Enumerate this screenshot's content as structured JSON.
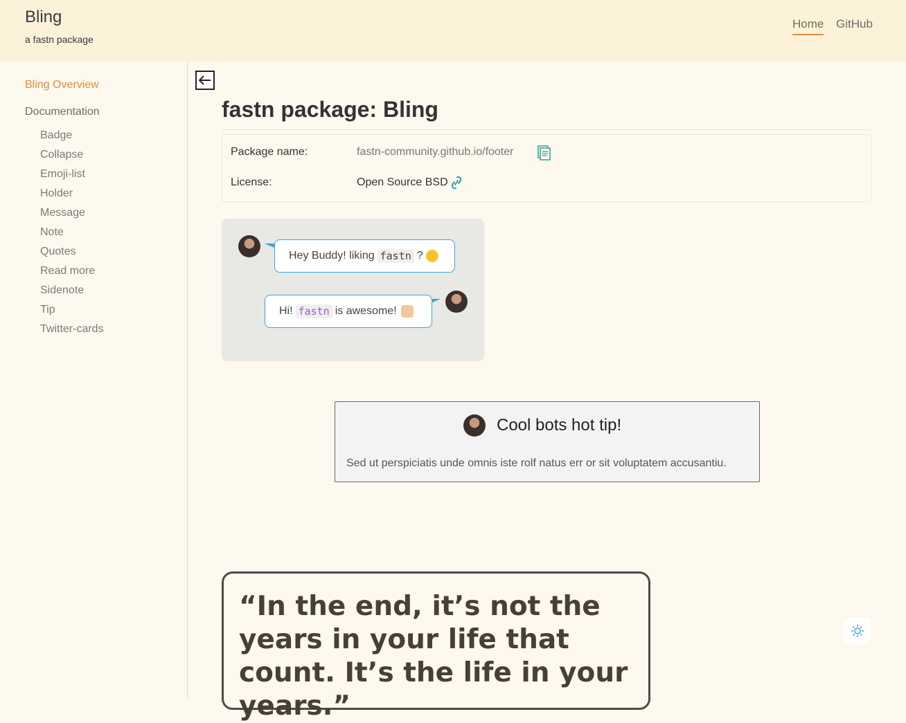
{
  "header": {
    "title": "Bling",
    "subtitle": "a fastn package",
    "nav": [
      {
        "label": "Home",
        "active": true
      },
      {
        "label": "GitHub",
        "active": false
      }
    ]
  },
  "sidebar": {
    "overview": "Bling Overview",
    "documentation": "Documentation",
    "items": [
      "Badge",
      "Collapse",
      "Emoji-list",
      "Holder",
      "Message",
      "Note",
      "Quotes",
      "Read more",
      "Sidenote",
      "Tip",
      "Twitter-cards"
    ]
  },
  "main": {
    "page_title": "fastn package: Bling",
    "package_label": "Package name:",
    "package_value": "fastn-community.github.io/footer",
    "license_label": "License:",
    "license_value": "Open Source BSD",
    "chat": {
      "msg1_pre": "Hey Buddy! liking",
      "msg1_code": "fastn",
      "msg1_post": "?",
      "msg2_pre": "Hi!",
      "msg2_code": "fastn",
      "msg2_post": "is awesome!"
    },
    "tip": {
      "title": "Cool bots hot tip!",
      "body": "Sed ut perspiciatis unde omnis iste rolf natus err or sit voluptatem accusantiu."
    },
    "quote": "“In the end, it’s not the years in your life that count. It’s the life in your years.”"
  },
  "colors": {
    "accent": "#e58a3b",
    "header_bg": "#fcf1d9",
    "page_bg": "#fdf9ee",
    "bubble_border": "#38a5d8"
  },
  "icons": [
    "back-arrow-icon",
    "copy-icon",
    "link-icon",
    "sun-icon",
    "smiley-emoji-icon",
    "thumbs-up-emoji-icon"
  ]
}
